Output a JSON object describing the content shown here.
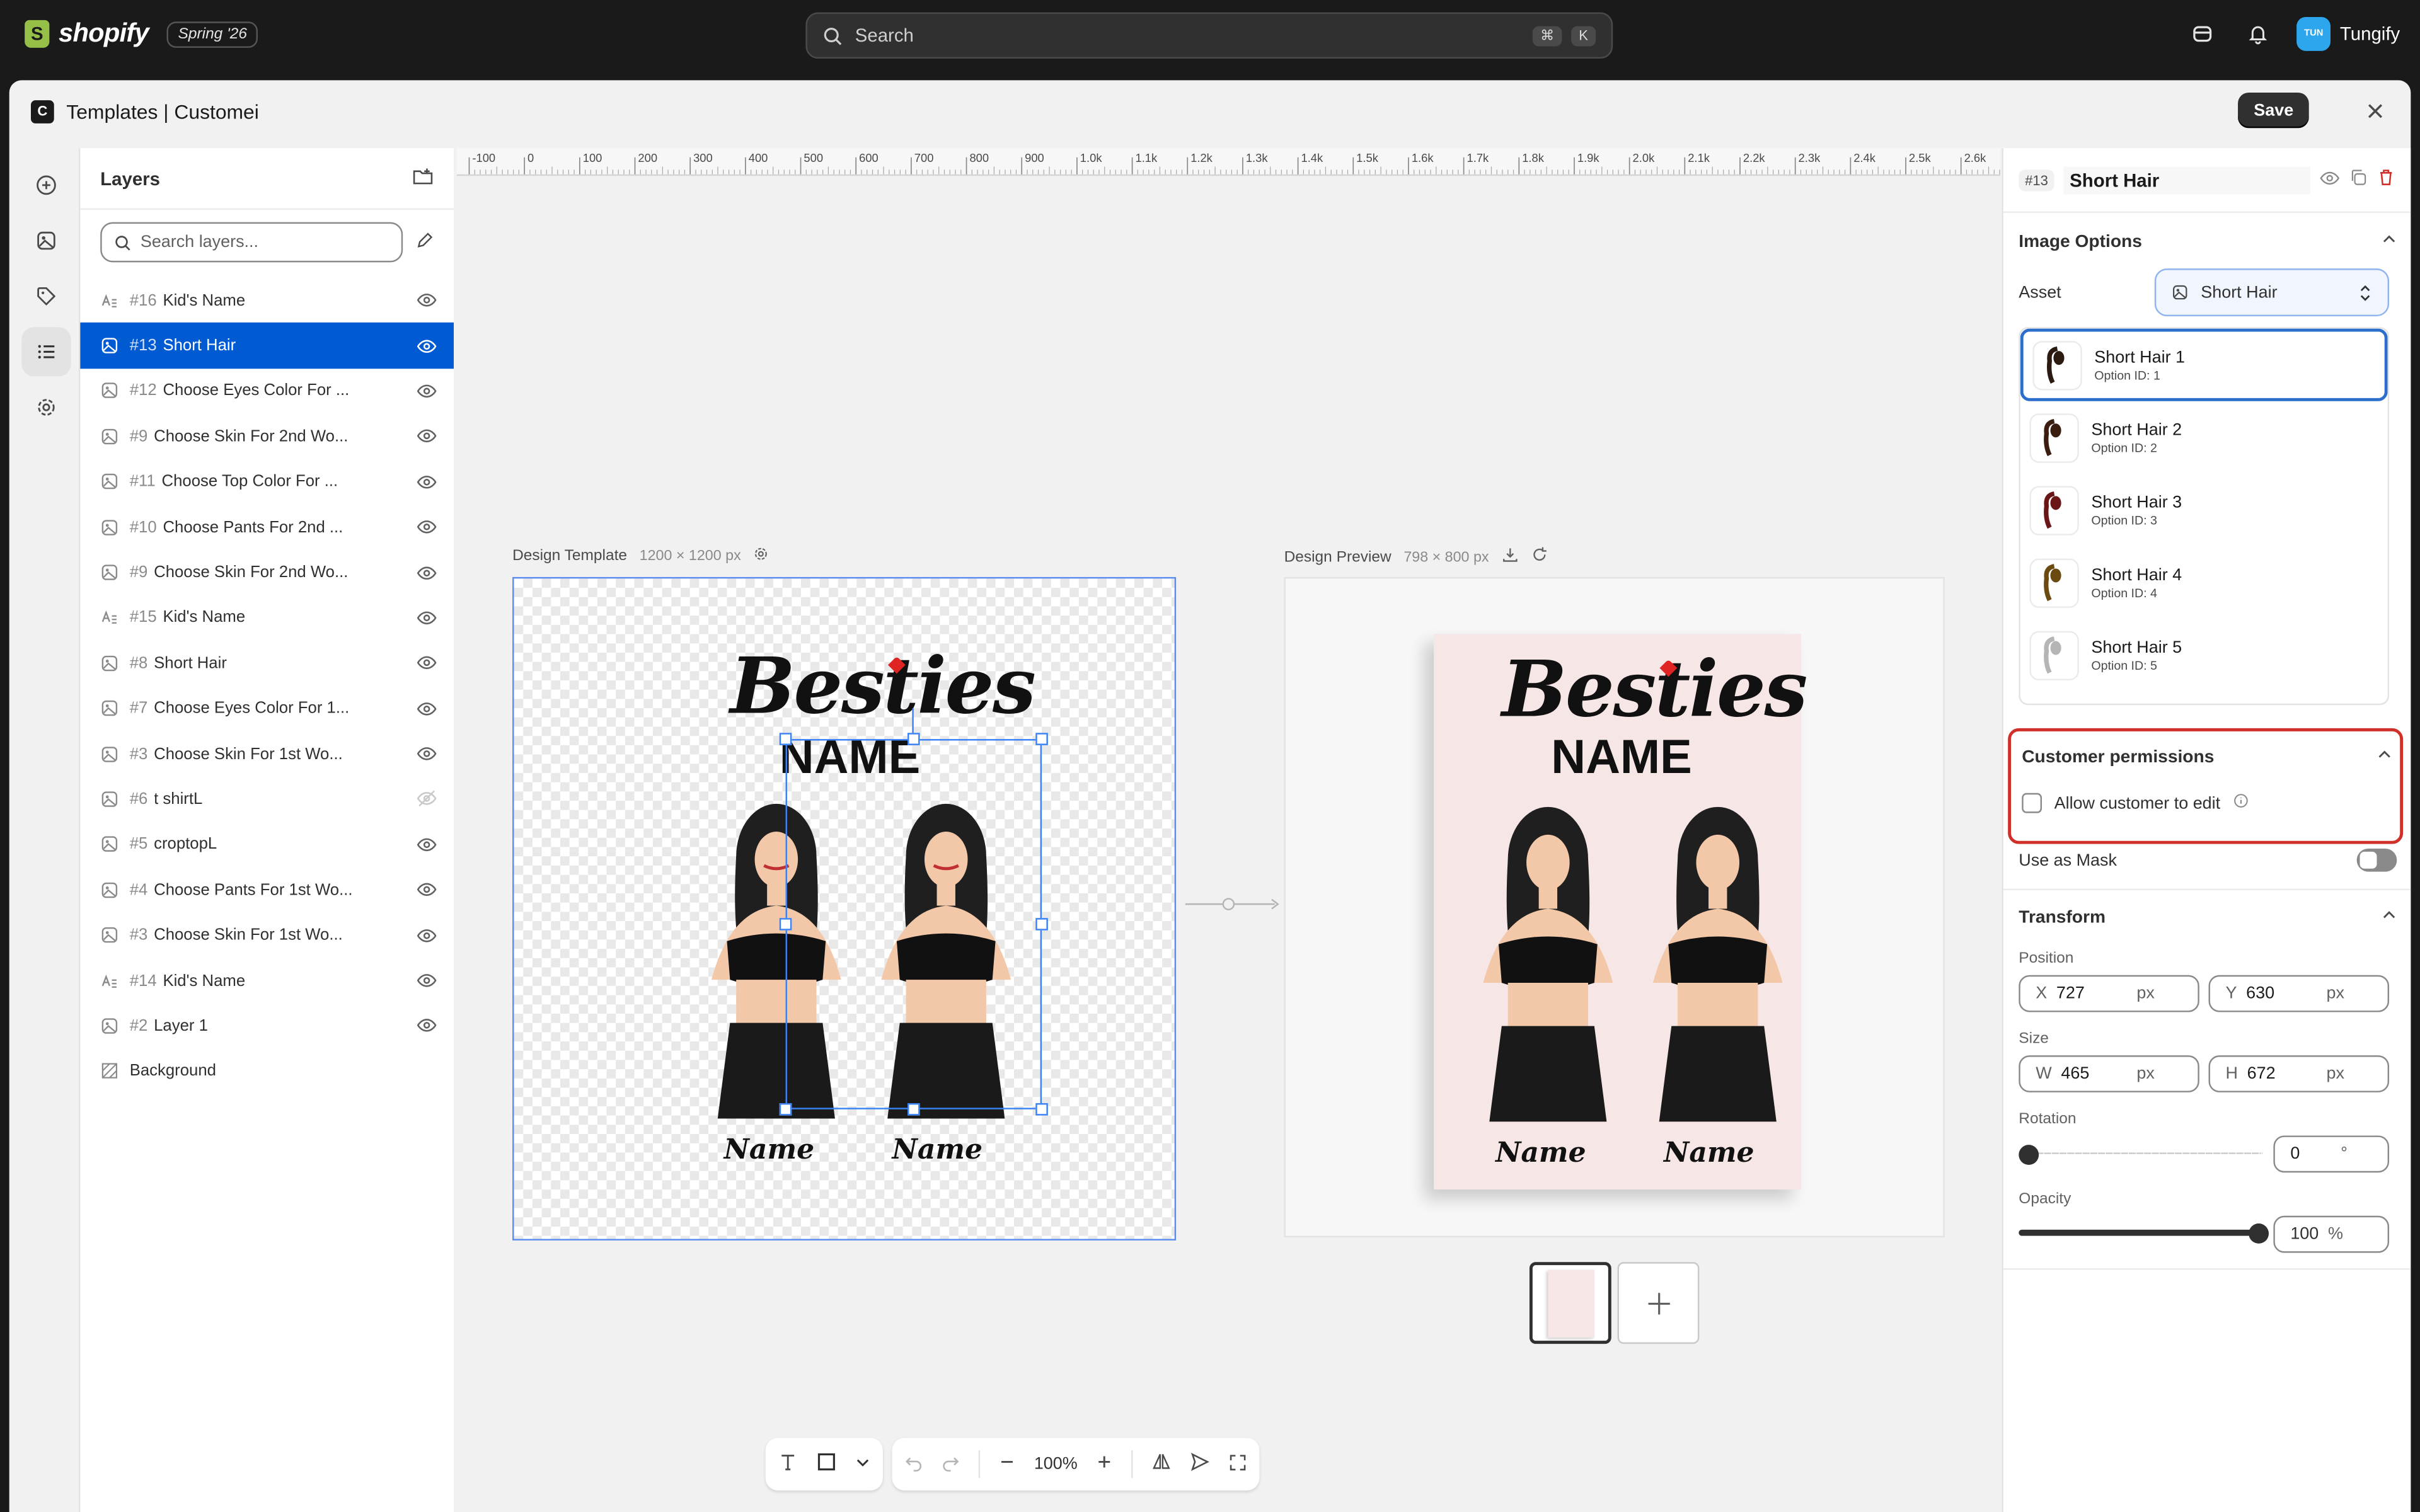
{
  "topbar": {
    "brand": "shopify",
    "season": "Spring '26",
    "search_placeholder": "Search",
    "shortcut_cmd": "⌘",
    "shortcut_key": "K",
    "avatar_initials": "TUN",
    "user_name": "Tungify"
  },
  "window": {
    "title": "Templates | Customei",
    "app_logo": "C",
    "save_label": "Save"
  },
  "layers": {
    "title": "Layers",
    "search_placeholder": "Search layers...",
    "items": [
      {
        "num": "#16",
        "name": "Kid's Name",
        "type": "text",
        "visible": true,
        "selected": false
      },
      {
        "num": "#13",
        "name": "Short Hair",
        "type": "image",
        "visible": true,
        "selected": true
      },
      {
        "num": "#12",
        "name": "Choose Eyes Color For ...",
        "type": "image",
        "visible": true,
        "selected": false
      },
      {
        "num": "#9",
        "name": "Choose Skin For 2nd Wo...",
        "type": "image",
        "visible": true,
        "selected": false
      },
      {
        "num": "#11",
        "name": "Choose Top Color For ...",
        "type": "image",
        "visible": true,
        "selected": false
      },
      {
        "num": "#10",
        "name": "Choose Pants For 2nd ...",
        "type": "image",
        "visible": true,
        "selected": false
      },
      {
        "num": "#9",
        "name": "Choose Skin For 2nd Wo...",
        "type": "image",
        "visible": true,
        "selected": false
      },
      {
        "num": "#15",
        "name": "Kid's Name",
        "type": "text",
        "visible": true,
        "selected": false
      },
      {
        "num": "#8",
        "name": "Short Hair",
        "type": "image",
        "visible": true,
        "selected": false
      },
      {
        "num": "#7",
        "name": "Choose Eyes Color For 1...",
        "type": "image",
        "visible": true,
        "selected": false
      },
      {
        "num": "#3",
        "name": "Choose Skin For 1st Wo...",
        "type": "image",
        "visible": true,
        "selected": false
      },
      {
        "num": "#6",
        "name": "t shirtL",
        "type": "image",
        "visible": false,
        "selected": false
      },
      {
        "num": "#5",
        "name": "croptopL",
        "type": "image",
        "visible": true,
        "selected": false
      },
      {
        "num": "#4",
        "name": "Choose Pants For 1st Wo...",
        "type": "image",
        "visible": true,
        "selected": false
      },
      {
        "num": "#3",
        "name": "Choose Skin For 1st Wo...",
        "type": "image",
        "visible": true,
        "selected": false
      },
      {
        "num": "#14",
        "name": "Kid's Name",
        "type": "text",
        "visible": true,
        "selected": false
      },
      {
        "num": "#2",
        "name": "Layer 1",
        "type": "image",
        "visible": true,
        "selected": false
      },
      {
        "num": "",
        "name": "Background",
        "type": "background",
        "visible": null,
        "selected": false
      }
    ]
  },
  "canvas": {
    "ruler_labels": [
      "-100",
      "0",
      "100",
      "200",
      "300",
      "400",
      "500",
      "600",
      "700",
      "800",
      "900",
      "1.0k",
      "1.1k",
      "1.2k",
      "1.3k",
      "1.4k",
      "1.5k",
      "1.6k",
      "1.7k",
      "1.8k",
      "1.9k",
      "2.0k",
      "2.1k",
      "2.2k",
      "2.3k",
      "2.4k",
      "2.5k",
      "2.6k"
    ],
    "template_label": "Design Template",
    "template_dims": "1200 × 1200 px",
    "preview_label": "Design Preview",
    "preview_dims": "798 × 800 px",
    "design": {
      "title": "Besties",
      "subtitle": "NAME",
      "name_left": "Name",
      "name_right": "Name"
    },
    "zoom": "100%",
    "colors": {
      "selection": "#3b82f6",
      "preview_bg": "#f6e6e6"
    }
  },
  "properties": {
    "badge": "#13",
    "layer_name": "Short Hair",
    "image_options_title": "Image Options",
    "asset_label": "Asset",
    "asset_value": "Short Hair",
    "options": [
      {
        "title": "Short Hair 1",
        "sub": "Option ID: 1",
        "selected": true,
        "hair": "#2a1a12"
      },
      {
        "title": "Short Hair 2",
        "sub": "Option ID: 2",
        "selected": false,
        "hair": "#3b1d10"
      },
      {
        "title": "Short Hair 3",
        "sub": "Option ID: 3",
        "selected": false,
        "hair": "#6b1616"
      },
      {
        "title": "Short Hair 4",
        "sub": "Option ID: 4",
        "selected": false,
        "hair": "#6b4a12"
      },
      {
        "title": "Short Hair 5",
        "sub": "Option ID: 5",
        "selected": false,
        "hair": "#b5b5b5"
      }
    ],
    "permissions_title": "Customer permissions",
    "allow_edit_label": "Allow customer to edit",
    "use_as_mask_label": "Use as Mask",
    "transform_title": "Transform",
    "position_label": "Position",
    "x_prefix": "X",
    "x_value": "727",
    "y_prefix": "Y",
    "y_value": "630",
    "size_label": "Size",
    "w_prefix": "W",
    "w_value": "465",
    "h_prefix": "H",
    "h_value": "672",
    "unit_px": "px",
    "rotation_label": "Rotation",
    "rotation_value": "0",
    "rotation_unit": "°",
    "opacity_label": "Opacity",
    "opacity_value": "100",
    "opacity_unit": "%",
    "colors": {
      "highlight": "#d0302a",
      "accent": "#2c6ecb"
    }
  }
}
